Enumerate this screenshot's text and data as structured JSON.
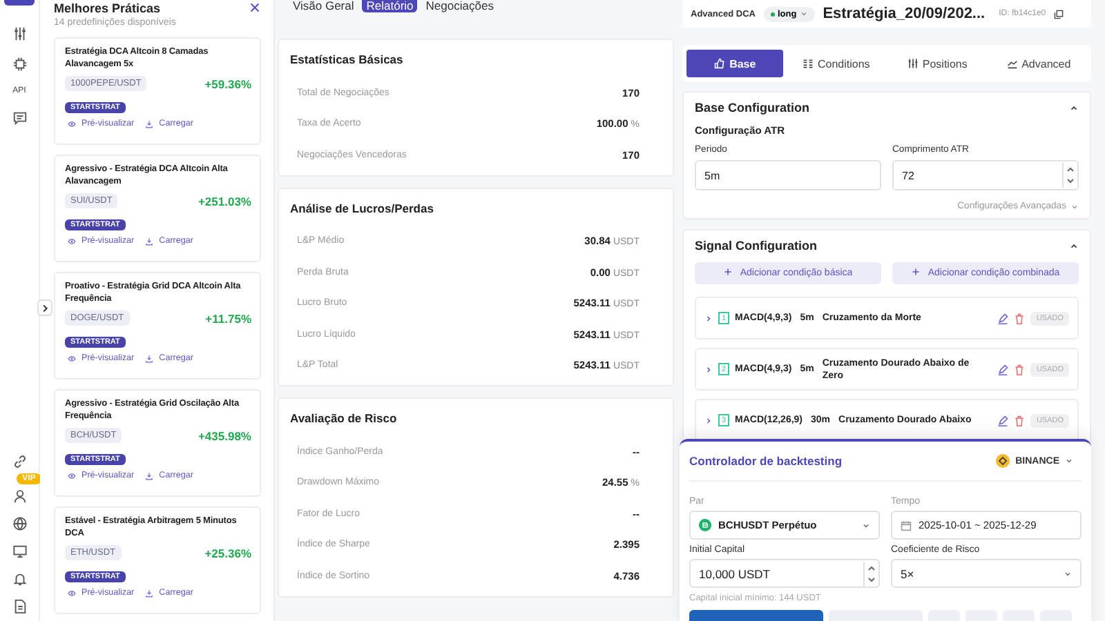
{
  "rail": {
    "api_label": "API",
    "vip_badge": "VIP"
  },
  "presets": {
    "title": "Melhores Práticas",
    "subtitle": "14 predefinições disponíveis",
    "cards": [
      {
        "title": "Estratégia DCA Altcoin 8 Camadas Alavancagem 5x",
        "pair": "1000PEPE/USDT",
        "return": "+59.36%",
        "tag": "STARTSTRAT",
        "preview": "Pré-visualizar",
        "load": "Carregar"
      },
      {
        "title": "Agressivo - Estratégia DCA Altcoin Alta Alavancagem",
        "pair": "SUI/USDT",
        "return": "+251.03%",
        "tag": "STARTSTRAT",
        "preview": "Pré-visualizar",
        "load": "Carregar"
      },
      {
        "title": "Proativo - Estratégia Grid DCA Altcoin Alta Frequência",
        "pair": "DOGE/USDT",
        "return": "+11.75%",
        "tag": "STARTSTRAT",
        "preview": "Pré-visualizar",
        "load": "Carregar"
      },
      {
        "title": "Agressivo - Estratégia Grid Oscilação Alta Frequência",
        "pair": "BCH/USDT",
        "return": "+435.98%",
        "tag": "STARTSTRAT",
        "preview": "Pré-visualizar",
        "load": "Carregar"
      },
      {
        "title": "Estável - Estratégia Arbitragem 5 Minutos DCA",
        "pair": "ETH/USDT",
        "return": "+25.36%",
        "tag": "STARTSTRAT",
        "preview": "Pré-visualizar",
        "load": "Carregar"
      }
    ]
  },
  "report_tabs": [
    {
      "label": "Visão Geral",
      "selected": false
    },
    {
      "label": "Relatório",
      "selected": true
    },
    {
      "label": "Negociações",
      "selected": false
    }
  ],
  "report_sections": [
    {
      "title": "Estatísticas Básicas",
      "rows": [
        {
          "label": "Total de Negociações",
          "value": "170"
        },
        {
          "label": "Taxa de Acerto",
          "value": "100.00",
          "unit": "%"
        },
        {
          "label": "Negociações Vencedoras",
          "value": "170"
        }
      ]
    },
    {
      "title": "Análise de Lucros/Perdas",
      "rows": [
        {
          "label": "L&P Médio",
          "value": "30.84",
          "unit": "USDT"
        },
        {
          "label": "Perda Bruta",
          "value": "0.00",
          "unit": "USDT"
        },
        {
          "label": "Lucro Bruto",
          "value": "5243.11",
          "unit": "USDT"
        },
        {
          "label": "Lucro Líquido",
          "value": "5243.11",
          "unit": "USDT"
        },
        {
          "label": "L&P Total",
          "value": "5243.11",
          "unit": "USDT"
        }
      ]
    },
    {
      "title": "Avaliação de Risco",
      "rows": [
        {
          "label": "Índice Ganho/Perda",
          "value": "--"
        },
        {
          "label": "Drawdown Máximo",
          "value": "24.55",
          "unit": "%"
        },
        {
          "label": "Fator de Lucro",
          "value": "--"
        },
        {
          "label": "Índice de Sharpe",
          "value": "2.395"
        },
        {
          "label": "Índice de Sortino",
          "value": "4.736"
        }
      ]
    }
  ],
  "strategy": {
    "type": "Advanced DCA",
    "direction": "long",
    "name": "Estratégia_20/09/202...",
    "id": "ID: fb14c1e0"
  },
  "config_tabs": [
    {
      "label": "Base",
      "kind": "base",
      "selected": true
    },
    {
      "label": "Conditions",
      "kind": "conditions",
      "selected": false
    },
    {
      "label": "Positions",
      "kind": "positions",
      "selected": false
    },
    {
      "label": "Advanced",
      "kind": "advanced",
      "selected": false
    }
  ],
  "base_config": {
    "title": "Base Configuration",
    "expanded": true,
    "subtitle": "Configuração ATR",
    "period_label": "Periodo",
    "period": "5m",
    "length_label": "Comprimento ATR",
    "length": "72",
    "advanced_link": "Configurações Avançadas"
  },
  "signal_config": {
    "title": "Signal Configuration",
    "expanded": true,
    "add_basic": "Adicionar condição básica",
    "add_combined": "Adicionar condição combinada",
    "conditions": [
      {
        "index": "1",
        "indicator": "MACD(4,9,3)",
        "timeframe": "5m",
        "condition": "Cruzamento da Morte",
        "status": "USADO"
      },
      {
        "index": "2",
        "indicator": "MACD(4,9,3)",
        "timeframe": "5m",
        "condition": "Cruzamento Dourado Abaixo de Zero",
        "status": "USADO"
      },
      {
        "index": "3",
        "indicator": "MACD(12,26,9)",
        "timeframe": "30m",
        "condition": "Cruzamento Dourado Abaixo",
        "status": "USADO"
      }
    ]
  },
  "backtest": {
    "title": "Controlador de backtesting",
    "exchange": "BINANCE",
    "pair_label": "Par",
    "pair": "BCHUSDT Perpétuo",
    "time_label": "Tempo",
    "time": "2025-10-01 ~ 2025-12-29",
    "capital_label": "Initial Capital",
    "capital": "10,000 USDT",
    "risk_label": "Coeficiente de Risco",
    "risk": "5×",
    "hint": "Capital inicial mínimo: 144 USDT"
  }
}
